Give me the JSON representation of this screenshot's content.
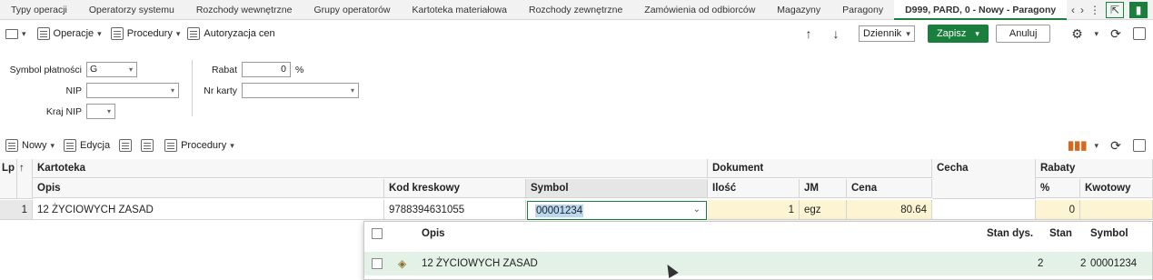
{
  "tabs": [
    {
      "label": "Typy operacji",
      "active": false
    },
    {
      "label": "Operatorzy systemu",
      "active": false
    },
    {
      "label": "Rozchody wewnętrzne",
      "active": false
    },
    {
      "label": "Grupy operatorów",
      "active": false
    },
    {
      "label": "Kartoteka materiałowa",
      "active": false
    },
    {
      "label": "Rozchody zewnętrzne",
      "active": false
    },
    {
      "label": "Zamówienia od odbiorców",
      "active": false
    },
    {
      "label": "Magazyny",
      "active": false
    },
    {
      "label": "Paragony",
      "active": false
    },
    {
      "label": "D999, PARD, 0 - Nowy - Paragony",
      "active": true
    }
  ],
  "toolbar": {
    "operacje": "Operacje",
    "procedury": "Procedury",
    "autoryzacja": "Autoryzacja cen",
    "dziennik": "Dziennik",
    "zapisz": "Zapisz",
    "anuluj": "Anuluj"
  },
  "form": {
    "symbol_platnosci_label": "Symbol płatności",
    "symbol_platnosci_value": "G",
    "nip_label": "NIP",
    "nip_value": "",
    "kraj_nip_label": "Kraj NIP",
    "kraj_nip_value": "",
    "rabat_label": "Rabat",
    "rabat_value": "0",
    "rabat_unit": "%",
    "nr_karty_label": "Nr karty",
    "nr_karty_value": ""
  },
  "toolbar2": {
    "nowy": "Nowy",
    "edycja": "Edycja",
    "procedury": "Procedury"
  },
  "grid": {
    "headers_top": {
      "lp": "Lp",
      "kartoteka": "Kartoteka",
      "dokument": "Dokument",
      "cecha": "Cecha",
      "rabaty": "Rabaty"
    },
    "headers_sub": {
      "opis": "Opis",
      "kod": "Kod kreskowy",
      "symbol": "Symbol",
      "ilosc": "Ilość",
      "jm": "JM",
      "cena": "Cena",
      "procent": "%",
      "kwotowy": "Kwotowy"
    },
    "row": {
      "lp": "1",
      "opis": "12 ŻYCIOWYCH ZASAD",
      "kod": "9788394631055",
      "symbol": "00001234",
      "ilosc": "1",
      "jm": "egz",
      "cena": "80.64",
      "cecha": "",
      "procent": "0",
      "kwotowy": ""
    }
  },
  "popup": {
    "headers": {
      "opis": "Opis",
      "stan_dys": "Stan dys.",
      "stan": "Stan",
      "symbol": "Symbol"
    },
    "row": {
      "opis": "12 ŻYCIOWYCH ZASAD",
      "stan_dys": "2",
      "stan": "2",
      "symbol": "00001234"
    }
  },
  "colors": {
    "accent": "#1a7f3c",
    "row_highlight": "#e3f1e6",
    "editable_cell": "#fdf4d3",
    "selection": "#b9d8f2"
  }
}
